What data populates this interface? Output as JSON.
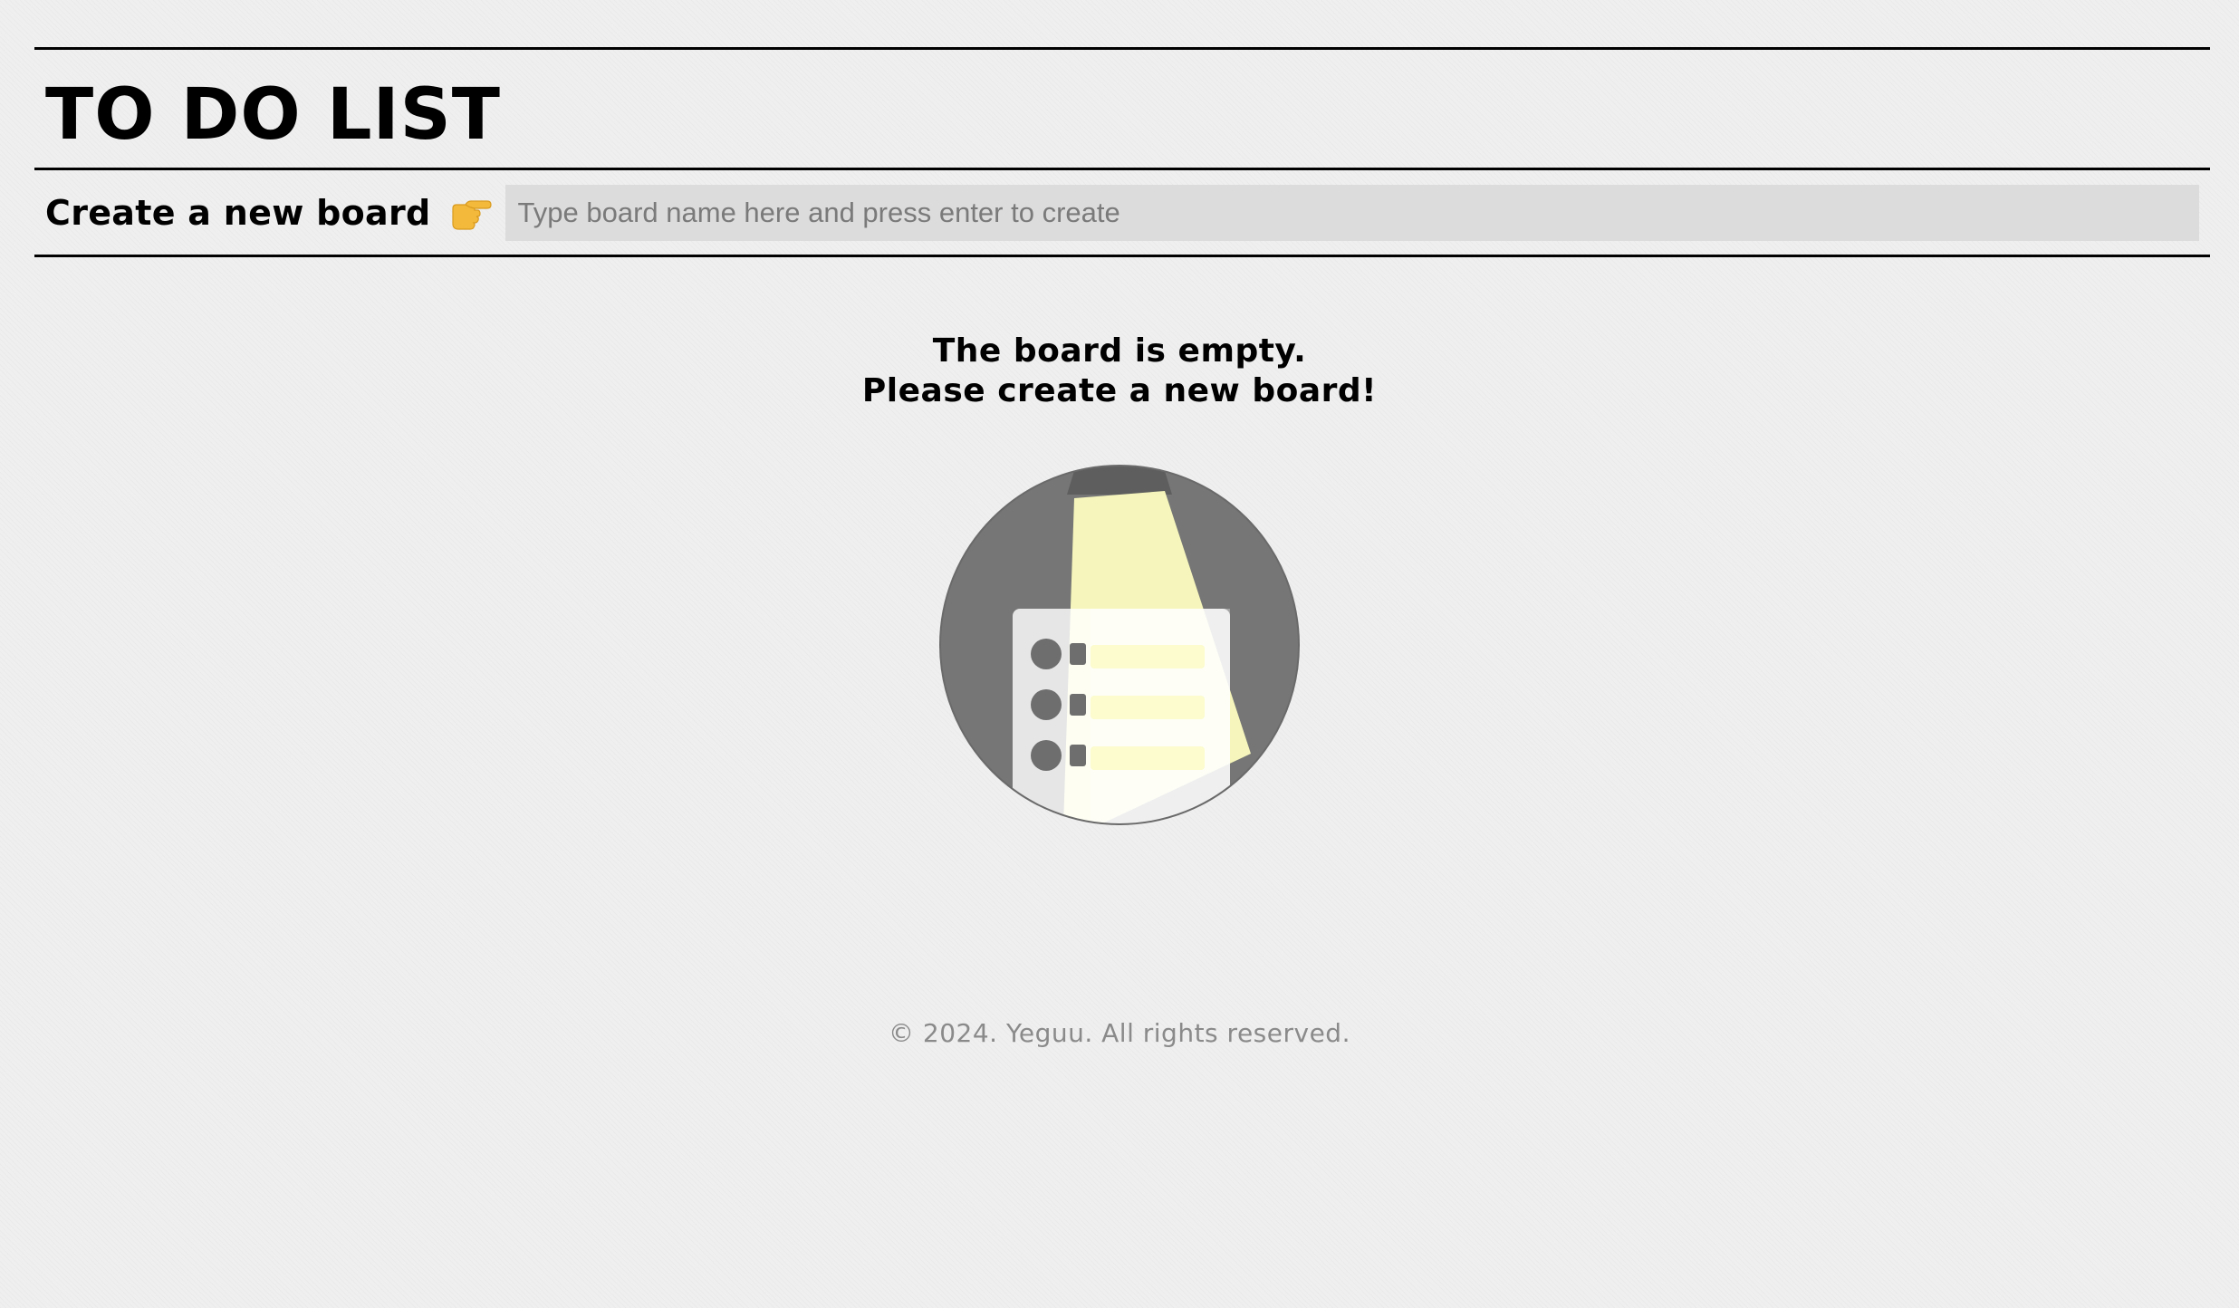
{
  "header": {
    "title": "TO DO LIST"
  },
  "create_board": {
    "label": "Create a new board",
    "pointer_icon": "pointing-hand-icon",
    "input_value": "",
    "input_placeholder": "Type board name here and press enter to create"
  },
  "empty_state": {
    "line1": "The board is empty.",
    "line2": "Please create a new board!",
    "illustration": "empty-board-illustration"
  },
  "footer": {
    "copyright": "© 2024. Yeguu. All rights reserved."
  },
  "colors": {
    "background": "#efefef",
    "rule": "#000000",
    "input_background": "#dcdcdc",
    "illustration_circle": "#767676",
    "illustration_highlight": "#fdfdc0",
    "footer_text": "#8a8a8a"
  }
}
